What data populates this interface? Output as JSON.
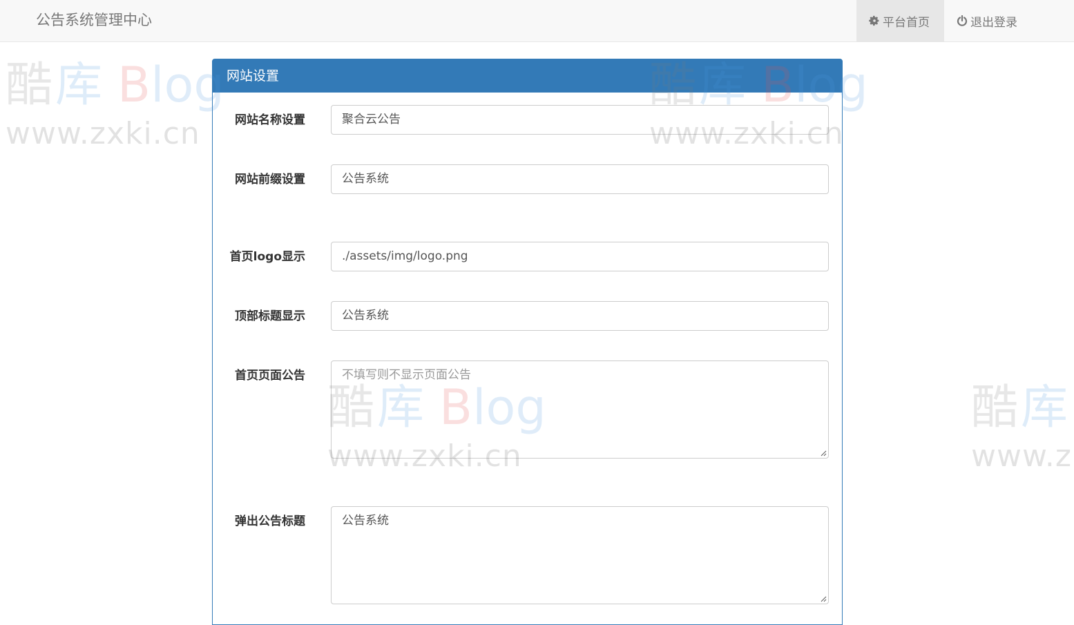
{
  "header": {
    "brand": "公告系统管理中心",
    "nav": [
      {
        "icon": "gear-icon",
        "label": "平台首页",
        "active": true
      },
      {
        "icon": "power-icon",
        "label": "退出登录",
        "active": false
      }
    ]
  },
  "watermark": {
    "line1": [
      "酷",
      "库",
      "B",
      "log"
    ],
    "line2": "www.zxki.cn",
    "partial_line1": [
      "酷",
      "库"
    ],
    "partial_line2": "www.z"
  },
  "panel": {
    "title": "网站设置",
    "fields": [
      {
        "label": "网站名称设置",
        "value": "聚合云公告",
        "placeholder": "",
        "type": "input"
      },
      {
        "label": "网站前缀设置",
        "value": "公告系统",
        "placeholder": "",
        "type": "input"
      },
      {
        "label": "首页logo显示",
        "value": "./assets/img/logo.png",
        "placeholder": "",
        "type": "input"
      },
      {
        "label": "顶部标题显示",
        "value": "公告系统",
        "placeholder": "",
        "type": "input"
      },
      {
        "label": "首页页面公告",
        "value": "",
        "placeholder": "不填写则不显示页面公告",
        "type": "textarea"
      },
      {
        "label": "弹出公告标题",
        "value": "公告系统",
        "placeholder": "",
        "type": "textarea"
      }
    ]
  },
  "colors": {
    "primary": "#337ab7",
    "navbar_bg": "#f8f8f8",
    "nav_active_bg": "#e7e7e7"
  }
}
